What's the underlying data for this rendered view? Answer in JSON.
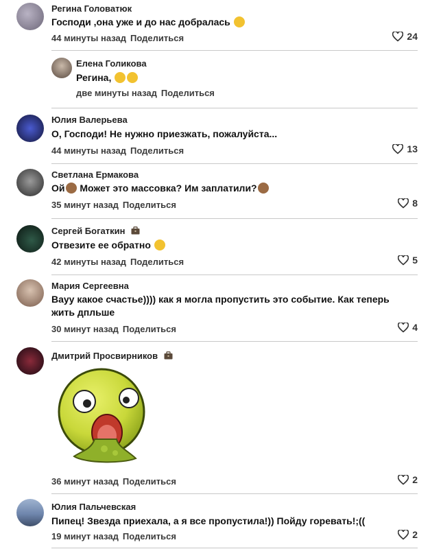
{
  "comments": [
    {
      "name": "Регина Головатюк",
      "text": "Господи ,она уже и до нас добралась",
      "time": "44 минуты назад",
      "share": "Поделиться",
      "likes": "24"
    },
    {
      "name": "Елена Голикова",
      "text": "Регина,",
      "time": "две минуты назад",
      "share": "Поделиться"
    },
    {
      "name": "Юлия Валерьева",
      "text": "О, Господи! Не нужно приезжать, пожалуйста...",
      "time": "44 минуты назад",
      "share": "Поделиться",
      "likes": "13"
    },
    {
      "name": "Светлана Ермакова",
      "text_a": "Ой",
      "text_b": " Может это массовка? Им заплатили?",
      "time": "35 минут назад",
      "share": "Поделиться",
      "likes": "8"
    },
    {
      "name": "Сергей Богаткин",
      "text": "Отвезите ее обратно",
      "time": "42 минуты назад",
      "share": "Поделиться",
      "likes": "5"
    },
    {
      "name": "Мария Сергеевна",
      "text_line1": "Вауу какое счастье)))) как я могла пропустить это событие. Как теперь",
      "text_line2": "жить дпльше",
      "time": "30 минут назад",
      "share": "Поделиться",
      "likes": "4"
    },
    {
      "name": "Дмитрий Просвирников",
      "time": "36 минут назад",
      "share": "Поделиться",
      "likes": "2"
    },
    {
      "name": "Юлия Пальчевская",
      "text": "Пипец! Звезда приехала, а я все пропустила!)) Пойду горевать!;((",
      "time": "19 минут назад",
      "share": "Поделиться",
      "likes": "2"
    }
  ],
  "colors": {
    "avatar_fill": "#3a3f55",
    "emoji_yellow": "#f2c230",
    "badge": "#5b4a3a",
    "divider": "#c8c8c8"
  },
  "icons": {
    "like": "heart-outline-icon",
    "badge": "briefcase-icon",
    "sticker": "nauseated-face-sticker"
  }
}
